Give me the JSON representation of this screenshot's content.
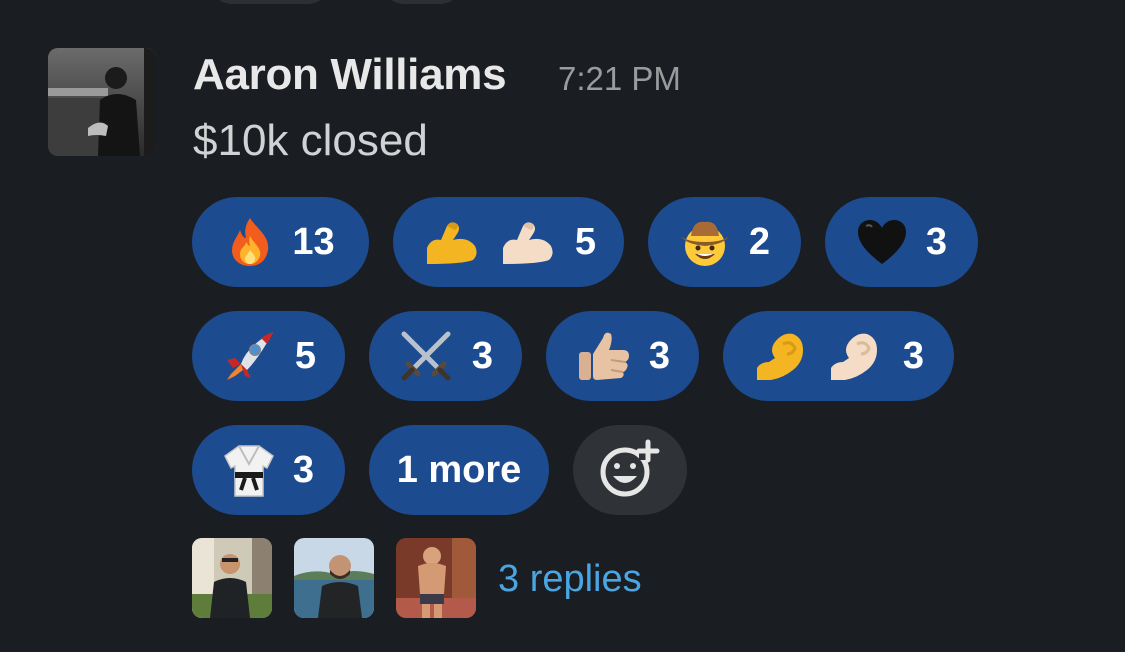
{
  "message": {
    "author": "Aaron Williams",
    "time": "7:21 PM",
    "text": "$10k closed"
  },
  "reactions": [
    {
      "icon": "fire-emoji",
      "count": "13"
    },
    {
      "icon": "flexed-biceps-emoji-pair",
      "count": "5"
    },
    {
      "icon": "cowboy-face-emoji",
      "count": "2"
    },
    {
      "icon": "black-heart-emoji",
      "count": "3"
    },
    {
      "icon": "rocket-emoji",
      "count": "5"
    },
    {
      "icon": "crossed-swords-emoji",
      "count": "3"
    },
    {
      "icon": "thumbs-up-emoji",
      "count": "3"
    },
    {
      "icon": "pinched-fingers-emoji-pair",
      "count": "3"
    },
    {
      "icon": "martial-arts-uniform-emoji",
      "count": "3"
    }
  ],
  "more_label": "1 more",
  "replies_label": "3 replies",
  "colors": {
    "background": "#1a1d21",
    "reaction_pill": "#1d4b8f",
    "link": "#4aa6e2"
  }
}
